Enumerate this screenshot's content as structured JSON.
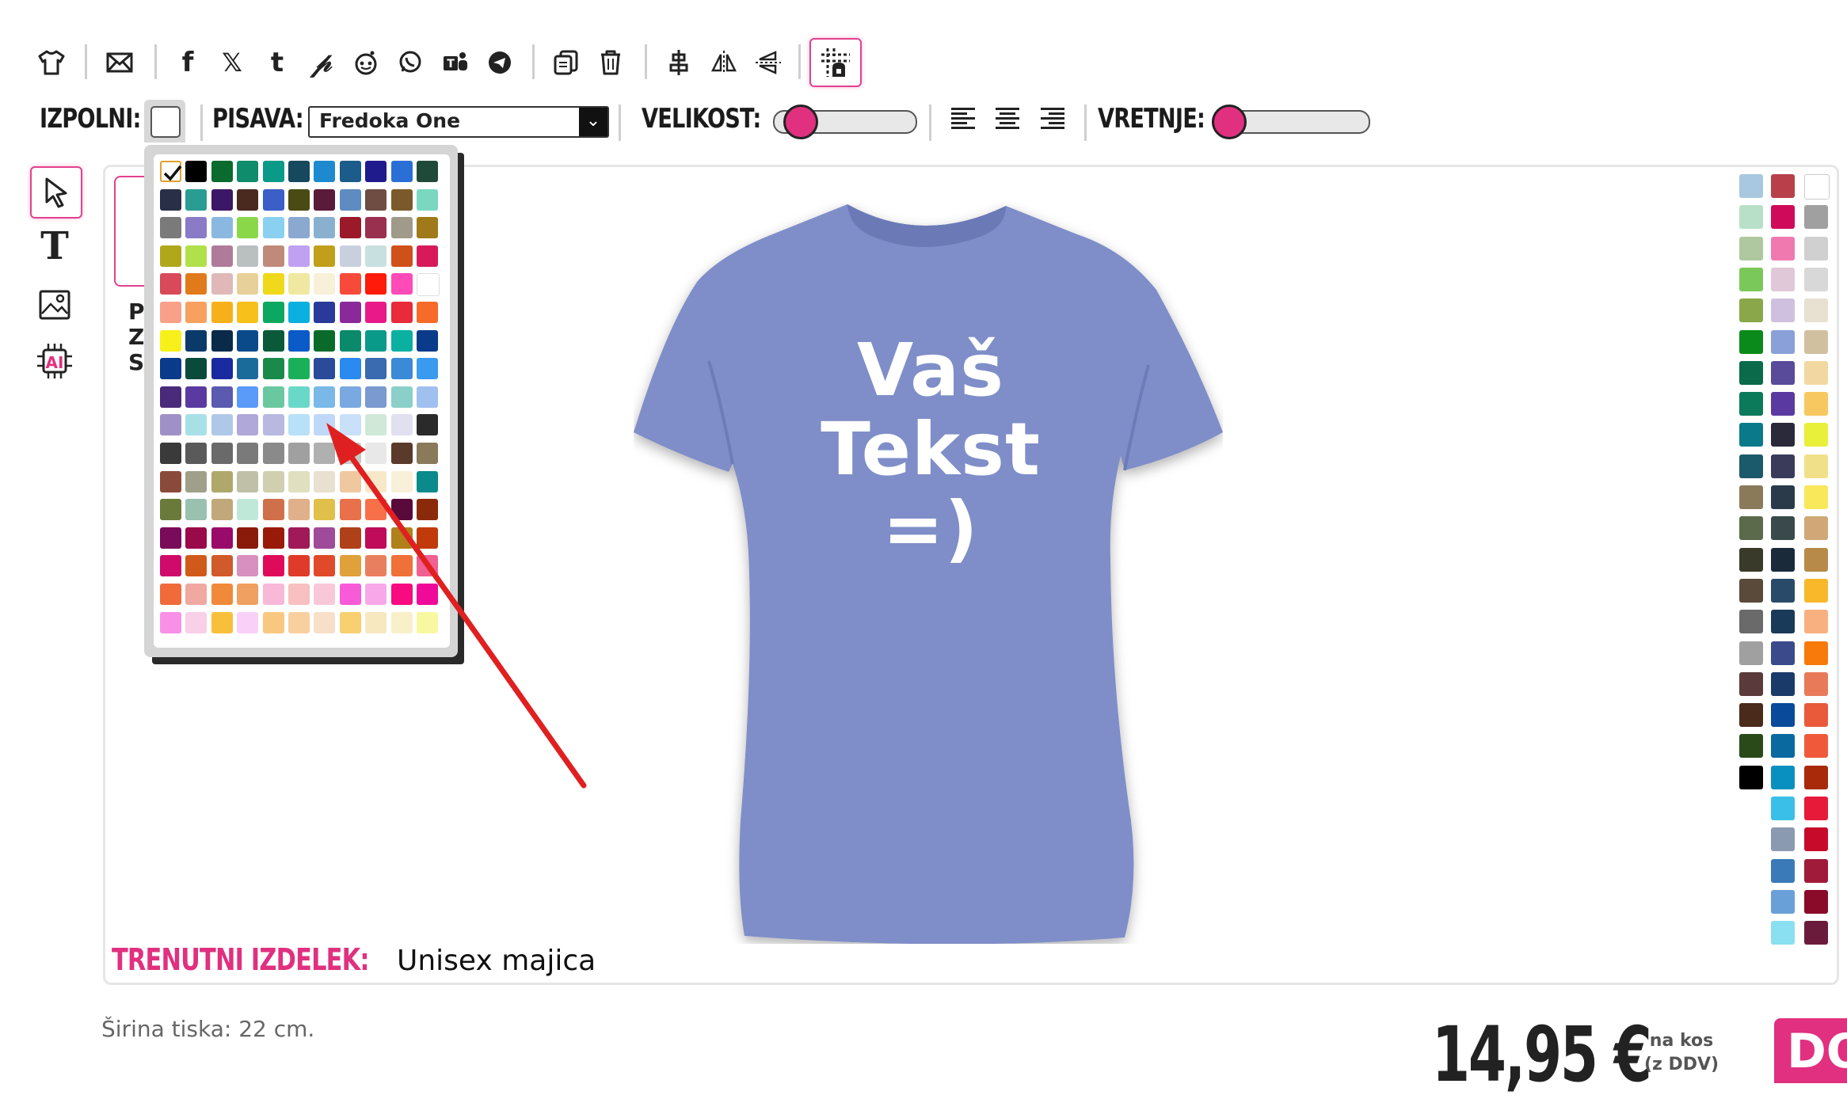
{
  "toolbar": {
    "icons": [
      "tshirt-icon",
      "mail-icon",
      "facebook-icon",
      "x-icon",
      "tumblr-icon",
      "pinterest-icon",
      "reddit-icon",
      "whatsapp-icon",
      "teams-icon",
      "telegram-icon",
      "copy-icon",
      "trash-icon",
      "align-center-icon",
      "flip-horizontal-icon",
      "flip-vertical-icon",
      "grid-icon"
    ]
  },
  "options": {
    "fill_label": "IZPOLNI:",
    "font_label": "PISAVA:",
    "font_value": "Fredoka One",
    "size_label": "VELIKOST:",
    "size_level": 0.1,
    "rotate_label": "VRETNJE:",
    "rotate_level": 0.0
  },
  "left_tools": [
    "select-tool",
    "text-tool",
    "image-tool",
    "ai-tool"
  ],
  "side_hint": {
    "lines": [
      "P",
      "ZA",
      "S"
    ]
  },
  "design": {
    "lines": [
      "Vaš",
      "Tekst",
      "=)"
    ],
    "shirt_color": "#7f8ec8"
  },
  "product": {
    "label": "TRENUTNI IZDELEK:",
    "name": "Unisex majica"
  },
  "footer": {
    "print_width": "Širina tiska: 22 cm.",
    "price": "14,95 €",
    "price_note": "na kos (z DDV)",
    "buy_label": "DOD"
  },
  "popup_colors": [
    [
      "#ffffff",
      "#000000",
      "#0a6b2e",
      "#0e8c6b",
      "#0a9a88",
      "#16485e",
      "#1d8ad0",
      "#1c5c8a",
      "#1f1b8c",
      "#2a6fd6",
      "#1f4a3a"
    ],
    [
      "#2a2f48",
      "#2a9d93",
      "#3c1766",
      "#4a2a1e",
      "#3b5fc6",
      "#4a4a14",
      "#5a1a3a",
      "#5e8cc0",
      "#6e4e42",
      "#7a5a2a",
      "#7ad8c0"
    ],
    [
      "#7a7a7a",
      "#8a7ac8",
      "#8ab8e0",
      "#8ad84a",
      "#8ad0f0",
      "#8aa8d0",
      "#8ab0d0",
      "#9a1a2a",
      "#9a3050",
      "#a09a8a",
      "#a07a1a"
    ],
    [
      "#b0a81a",
      "#b0e04a",
      "#b07a9a",
      "#bac0c0",
      "#c08a7a",
      "#c0a0f0",
      "#c0a01a",
      "#c8d0e0",
      "#c8e0e0",
      "#d0501a",
      "#d81a5a"
    ],
    [
      "#d84a5a",
      "#e07a1a",
      "#e0b8b8",
      "#e8d09a",
      "#f0d81a",
      "#f0e8a0",
      "#f8f0d8",
      "#f84a3a",
      "#ff1a0a",
      "#ff4ab8",
      "#ffffff"
    ],
    [
      "#f8a088",
      "#f8a060",
      "#f8b01a",
      "#f8c01a",
      "#0aa860",
      "#0ab0e0",
      "#2a3a9a",
      "#8a2a9a",
      "#e81a8a",
      "#e82a3a",
      "#f86a2a"
    ],
    [
      "#f8f01a",
      "#0a3a6a",
      "#0a2a4a",
      "#0a4a8a",
      "#0a5a3a",
      "#0a5ac8",
      "#0a6a2a",
      "#0a8a6a",
      "#0a9a8a",
      "#0ab0a0",
      "#0a3a8a"
    ],
    [
      "#0a3a8a",
      "#0a4a3a",
      "#1a2aa0",
      "#1a6a9a",
      "#1a8a4a",
      "#1ab05a",
      "#2a4a9a",
      "#2a8af0",
      "#3a6ab0",
      "#3a8ad8",
      "#3a9af0"
    ],
    [
      "#4a2a7a",
      "#5a3aa0",
      "#5a5ab0",
      "#5a9af8",
      "#6ac8a0",
      "#6ad8c8",
      "#7ab8e8",
      "#7aa8e0",
      "#7a9ad0",
      "#8ad0c8",
      "#a0c0f0"
    ],
    [
      "#a090c8",
      "#a8e0e8",
      "#b0c8e8",
      "#b0a8d8",
      "#b8b8e0",
      "#b8e0f8",
      "#c0d8f8",
      "#c8e0f8",
      "#d0e8d8",
      "#e0e0f0",
      "#2a2a2a"
    ],
    [
      "#3a3a3a",
      "#5a5a5a",
      "#6a6a6a",
      "#7a7a7a",
      "#8a8a8a",
      "#a0a0a0",
      "#b0b0b0",
      "#c8c8c8",
      "#e8e8e8",
      "#5a3a2a",
      "#8a7a5a"
    ],
    [
      "#8a4a3a",
      "#a0a08a",
      "#b0a86a",
      "#c0c0a8",
      "#d0d0b0",
      "#e0e0c0",
      "#e8e0d0",
      "#f0c8a0",
      "#f8e8c8",
      "#f8f0d8",
      "#0a8a8a"
    ],
    [
      "#6a7a3a",
      "#9ac0b0",
      "#c0a87a",
      "#c0e8d8",
      "#d0704a",
      "#e0b08a",
      "#e0c04a",
      "#e8704a",
      "#f8704a",
      "#5a0a3a",
      "#8a2a0a"
    ],
    [
      "#7a0a5a",
      "#9a0a4a",
      "#9a0a6a",
      "#8a1a0a",
      "#9a1a0a",
      "#a01a5a",
      "#a04a9a",
      "#b0401a",
      "#c00a5a",
      "#b0801a",
      "#c03a0a"
    ],
    [
      "#d00a6a",
      "#d05a1a",
      "#d05a2a",
      "#d890c0",
      "#e00a5a",
      "#e03a2a",
      "#e04a2a",
      "#e0a03a",
      "#e88060",
      "#f0703a",
      "#f06090"
    ],
    [
      "#f06a3a",
      "#f0a8a0",
      "#f08a3a",
      "#f0a060",
      "#f8b8d8",
      "#f8c0c0",
      "#f8c8d8",
      "#f85ad8",
      "#f8a8e8",
      "#f80a80",
      "#f00a9a"
    ],
    [
      "#f890e8",
      "#f8d0e8",
      "#f8c03a",
      "#f8d0f8",
      "#f8c880",
      "#f8d0a0",
      "#f8e0c8",
      "#f8d070",
      "#f8e8c0",
      "#f8f0c8",
      "#f8f8a0"
    ]
  ],
  "right_palette": [
    [
      "#a8c8e0",
      "#b8404a",
      "#ffffff"
    ],
    [
      "#b8e0c8",
      "#d00a5a",
      "#a0a0a0"
    ],
    [
      "#b0c8a0",
      "#f07ab0",
      "#d0d0d0"
    ],
    [
      "#7ac85a",
      "#e0c8d8",
      "#d8d8d8"
    ],
    [
      "#8aa84a",
      "#d0c0e0",
      "#e8e0d0"
    ],
    [
      "#0a8a1a",
      "#8aa0d8",
      "#d0c0a0"
    ],
    [
      "#0a6a4a",
      "#5a4a9a",
      "#f0d8a0"
    ],
    [
      "#0a7a5a",
      "#5a3aa0",
      "#f8c860"
    ],
    [
      "#0a7a8a",
      "#2a2a3a",
      "#e8f03a"
    ],
    [
      "#1a5a6a",
      "#3a3a5a",
      "#f0e08a"
    ],
    [
      "#8a7a5a",
      "#2a3a4a",
      "#f8e85a"
    ],
    [
      "#5a6a4a",
      "#3a4a4a",
      "#d0a878"
    ],
    [
      "#3a3a2a",
      "#1a2a3a",
      "#b88a4a"
    ],
    [
      "#5a4a3a",
      "#2a4a6a",
      "#f8b82a"
    ],
    [
      "#6a6a6a",
      "#1a3a5a",
      "#f8b080"
    ],
    [
      "#a0a0a0",
      "#3a4a8a",
      "#f87a0a"
    ],
    [
      "#5a3a3a",
      "#1a3a6a",
      "#e87a5a"
    ],
    [
      "#4a2a1a",
      "#0a4a9a",
      "#e85a3a"
    ],
    [
      "#2a4a1a",
      "#0a6aa0",
      "#f05a3a"
    ],
    [
      "#000000",
      "#0a90c0",
      "#a82a0a"
    ],
    [
      "",
      "#3ac0e8",
      "#e81a3a"
    ],
    [
      "",
      "#8a9ab0",
      "#c80a2a"
    ],
    [
      "",
      "#3a7ab8",
      "#a01a3a"
    ],
    [
      "",
      "#6aa0d8",
      "#8a0a2a"
    ],
    [
      "",
      "#8ae0f0",
      "#6a1a3a"
    ]
  ]
}
